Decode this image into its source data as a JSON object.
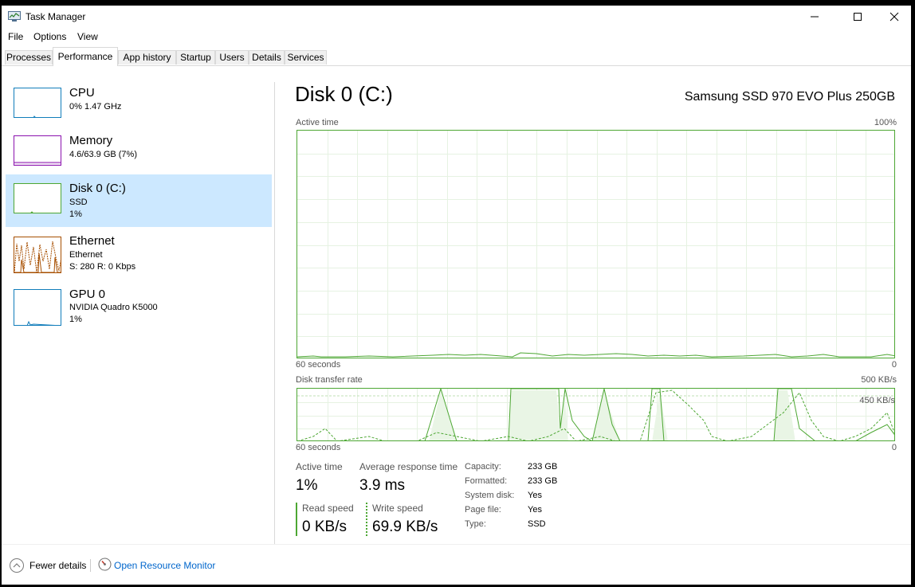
{
  "window": {
    "title": "Task Manager"
  },
  "menu": [
    "File",
    "Options",
    "View"
  ],
  "tabs": [
    "Processes",
    "Performance",
    "App history",
    "Startup",
    "Users",
    "Details",
    "Services"
  ],
  "sidebar": {
    "items": [
      {
        "name": "CPU",
        "line1": "0% 1.47 GHz",
        "color": "#117dbb"
      },
      {
        "name": "Memory",
        "line1": "4.6/63.9 GB (7%)",
        "color": "#8b12ae"
      },
      {
        "name": "Disk 0 (C:)",
        "line1": "SSD",
        "line2": "1%",
        "color": "#4da733",
        "selected": true
      },
      {
        "name": "Ethernet",
        "line1": "Ethernet",
        "line2": "S: 280 R: 0 Kbps",
        "color": "#a74f01"
      },
      {
        "name": "GPU 0",
        "line1": "NVIDIA Quadro K5000",
        "line2": "1%",
        "color": "#117dbb"
      }
    ]
  },
  "main": {
    "title": "Disk 0 (C:)",
    "model": "Samsung SSD 970 EVO Plus 250GB",
    "active_graph": {
      "label": "Active time",
      "max": "100%",
      "time": "60 seconds",
      "min": "0"
    },
    "transfer_graph": {
      "label": "Disk transfer rate",
      "max": "500 KB/s",
      "inner": "450 KB/s",
      "time": "60 seconds",
      "min": "0"
    },
    "stats": {
      "active_time_label": "Active time",
      "active_time": "1%",
      "avg_resp_label": "Average response time",
      "avg_resp": "3.9 ms",
      "read_label": "Read speed",
      "read": "0 KB/s",
      "write_label": "Write speed",
      "write": "69.9 KB/s"
    },
    "props": [
      {
        "k": "Capacity:",
        "v": "233 GB"
      },
      {
        "k": "Formatted:",
        "v": "233 GB"
      },
      {
        "k": "System disk:",
        "v": "Yes"
      },
      {
        "k": "Page file:",
        "v": "Yes"
      },
      {
        "k": "Type:",
        "v": "SSD"
      }
    ]
  },
  "footer": {
    "fewer": "Fewer details",
    "resmon": "Open Resource Monitor"
  },
  "colors": {
    "disk": "#4da733",
    "disk_fill": "#e9f5e5",
    "grid": "#e6f2e2",
    "selected": "#cce8ff",
    "link": "#0066cc"
  }
}
